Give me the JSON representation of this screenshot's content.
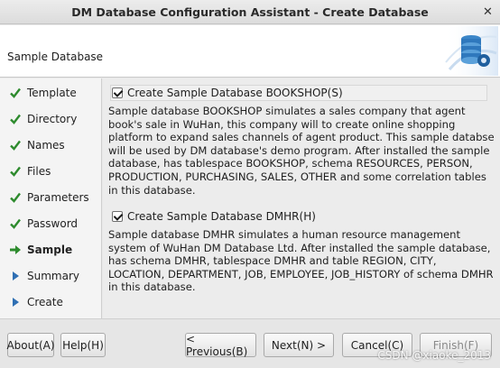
{
  "window": {
    "title": "DM Database Configuration Assistant - Create Database"
  },
  "header": {
    "page_title": "Sample Database"
  },
  "sidebar": {
    "steps": [
      {
        "label": "Template",
        "state": "done"
      },
      {
        "label": "Directory",
        "state": "done"
      },
      {
        "label": "Names",
        "state": "done"
      },
      {
        "label": "Files",
        "state": "done"
      },
      {
        "label": "Parameters",
        "state": "done"
      },
      {
        "label": "Password",
        "state": "done"
      },
      {
        "label": "Sample",
        "state": "current"
      },
      {
        "label": "Summary",
        "state": "pending"
      },
      {
        "label": "Create",
        "state": "pending"
      }
    ]
  },
  "content": {
    "bookshop": {
      "checkbox_label": "Create Sample Database BOOKSHOP(S)",
      "checked": true,
      "description": "Sample database BOOKSHOP simulates a sales company that agent book's sale in WuHan, this company will to create online shopping platform to expand sales channels of agent product. This sample databse will be used by DM database's demo program. After installed the sample database, has tablespace BOOKSHOP, schema RESOURCES, PERSON, PRODUCTION, PURCHASING, SALES, OTHER and some correlation tables in this database."
    },
    "dmhr": {
      "checkbox_label": "Create Sample Database DMHR(H)",
      "checked": true,
      "description": "Sample database DMHR simulates a human resource management system of WuHan DM Database Ltd. After installed the sample database, has schema DMHR, tablespace DMHR and table REGION, CITY, LOCATION, DEPARTMENT, JOB, EMPLOYEE, JOB_HISTORY of schema DMHR in this database."
    }
  },
  "footer": {
    "about_label": "About(A)",
    "help_label": "Help(H)",
    "previous_label": "< Previous(B)",
    "next_label": "Next(N) >",
    "cancel_label": "Cancel(C)",
    "finish_label": "Finish(F)"
  },
  "watermark": "CSDN @xiaoke_2013",
  "colors": {
    "done_check": "#2e8b2e",
    "current_arrow": "#2e8b2e",
    "pending_arrow": "#2f6fb3"
  }
}
